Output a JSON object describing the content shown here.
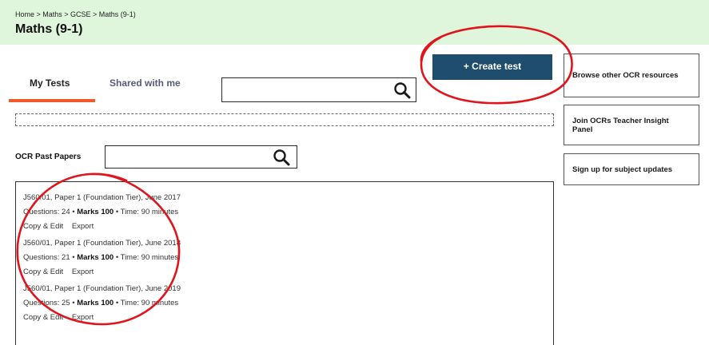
{
  "header": {
    "breadcrumb": "Home > Maths > GCSE > Maths (9-1)",
    "title": "Maths (9-1)"
  },
  "tabs": [
    {
      "label": "My Tests",
      "active": true
    },
    {
      "label": "Shared with me",
      "active": false
    }
  ],
  "create_button": {
    "label": "+ Create test"
  },
  "past_papers": {
    "label": "OCR Past Papers"
  },
  "sidebar": [
    {
      "label": "Browse other OCR resources"
    },
    {
      "label": "Join OCRs Teacher Insight Panel"
    },
    {
      "label": "Sign up for subject updates"
    }
  ],
  "papers": [
    {
      "title": "J560/01, Paper 1 (Foundation Tier), June 2017",
      "questions_text": "Questions: 24 •",
      "marks_text": "Marks 100",
      "time_text": "• Time: 90 minutes",
      "copy_label": "Copy & Edit",
      "export_label": "Export"
    },
    {
      "title": "J560/01, Paper 1 (Foundation Tier), June 2018",
      "questions_text": "Questions: 21 •",
      "marks_text": "Marks 100",
      "time_text": "• Time: 90 minutes",
      "copy_label": "Copy & Edit",
      "export_label": "Export"
    },
    {
      "title": "J560/01, Paper 1 (Foundation Tier), June 2019",
      "questions_text": "Questions: 25 •",
      "marks_text": "Marks 100",
      "time_text": "• Time: 90 minutes",
      "copy_label": "Copy & Edit",
      "export_label": "Export"
    }
  ],
  "colors": {
    "header_bg": "#dff5dc",
    "accent_underline": "#f05a28",
    "button_bg": "#1f4d6e",
    "annotation_red": "#e0151b"
  }
}
